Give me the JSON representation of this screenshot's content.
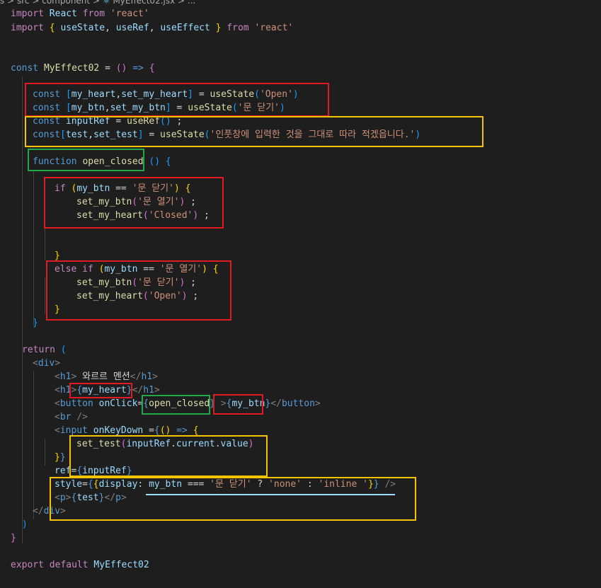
{
  "breadcrumb": {
    "segments": [
      "s",
      "src",
      "component"
    ],
    "separator": ">",
    "file": "MyEffect02.jsx",
    "tail": "...",
    "file_icon": "react-icon"
  },
  "editor": {
    "language": "jsx",
    "theme": "dark",
    "lines": [
      "import React from 'react'",
      "import { useState, useRef, useEffect } from 'react'",
      "",
      "",
      "const MyEffect02 = () => {",
      "",
      "    const [my_heart,set_my_heart] = useState('Open')",
      "    const [my_btn,set_my_btn] = useState('문 닫기')",
      "    const inputRef = useRef() ;",
      "    const[test,set_test] = useState('인풋창에 입력한 것을 그대로 따라 적겠읍니다.')",
      "",
      "    function open_closed () {",
      "",
      "        if (my_btn == '문 닫기') {",
      "            set_my_btn('문 열기') ;",
      "            set_my_heart('Closed') ;",
      "",
      "",
      "        }",
      "        else if (my_btn == '문 열기') {",
      "            set_my_btn('문 닫기') ;",
      "            set_my_heart('Open') ;",
      "        }",
      "    }",
      "",
      "  return (",
      "    <div>",
      "        <h1> 와르르 멘션</h1>",
      "        <h1>{my_heart}</h1>",
      "        <button onClick={open_closed} >{my_btn}</button>",
      "        <br />",
      "        <input onKeyDown ={() => {",
      "            set_test(inputRef.current.value)",
      "        }}",
      "        ref={inputRef}",
      "        style={{display: my_btn === '문 닫기' ? 'none' : 'inline '}} />",
      "        <p>{test}</p>",
      "    </div>",
      "  )",
      "}",
      "",
      "export default MyEffect02"
    ]
  },
  "annotations": {
    "colors": {
      "red": "#e01b24",
      "yellow": "#f5c400",
      "green": "#22a84a",
      "underline": "#9cdcfe"
    }
  }
}
